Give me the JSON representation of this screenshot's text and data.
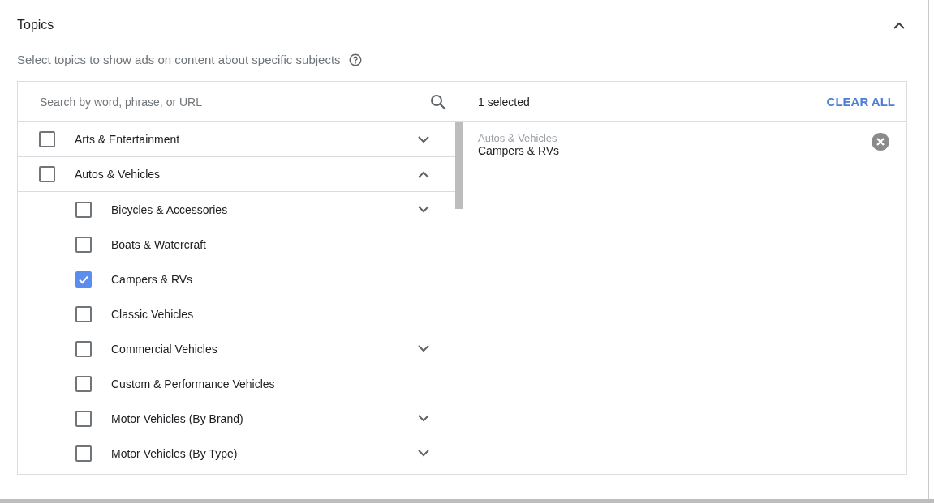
{
  "section": {
    "title": "Topics",
    "expanded": true,
    "description": "Select topics to show ads on content about specific subjects"
  },
  "search": {
    "placeholder": "Search by word, phrase, or URL"
  },
  "topics": [
    {
      "label": "Arts & Entertainment",
      "kind": "group",
      "checked": false,
      "expanded": false
    },
    {
      "label": "Autos & Vehicles",
      "kind": "group",
      "checked": false,
      "expanded": true,
      "children": [
        {
          "label": "Bicycles & Accessories",
          "kind": "group",
          "checked": false,
          "expanded": false
        },
        {
          "label": "Boats & Watercraft",
          "kind": "leaf",
          "checked": false
        },
        {
          "label": "Campers & RVs",
          "kind": "leaf",
          "checked": true
        },
        {
          "label": "Classic Vehicles",
          "kind": "leaf",
          "checked": false
        },
        {
          "label": "Commercial Vehicles",
          "kind": "group",
          "checked": false,
          "expanded": false
        },
        {
          "label": "Custom & Performance Vehicles",
          "kind": "leaf",
          "checked": false
        },
        {
          "label": "Motor Vehicles (By Brand)",
          "kind": "group",
          "checked": false,
          "expanded": false
        },
        {
          "label": "Motor Vehicles (By Type)",
          "kind": "group",
          "checked": false,
          "expanded": false
        }
      ]
    }
  ],
  "selection": {
    "count": "1 selected",
    "clear_button": "CLEAR ALL",
    "items": [
      {
        "parent": "Autos & Vehicles",
        "label": "Campers & RVs"
      }
    ]
  }
}
